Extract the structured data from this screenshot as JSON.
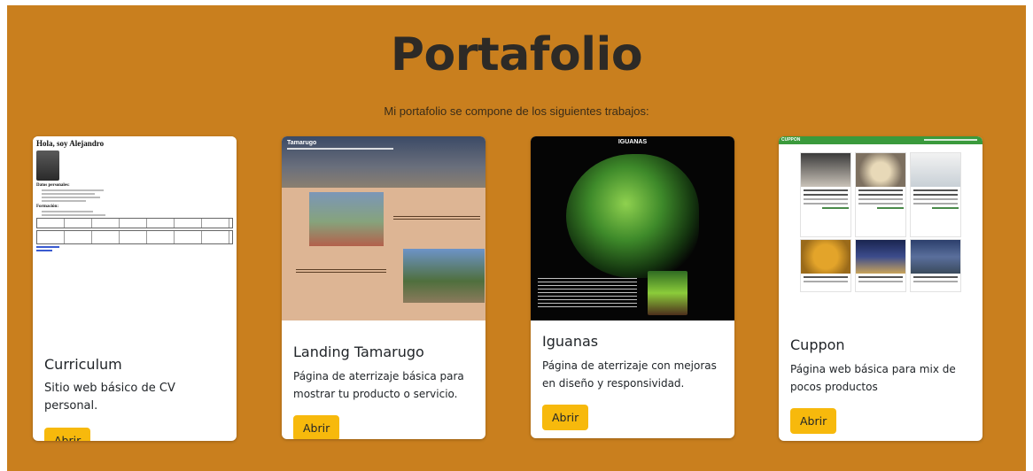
{
  "page": {
    "title": "Portafolio",
    "subtitle": "Mi portafolio se compone de los siguientes trabajos:"
  },
  "colors": {
    "section_bg": "#c97f1e",
    "title": "#2d2a26",
    "button": "#f7b90c",
    "card_bg": "#ffffff"
  },
  "cards": [
    {
      "title": "Curriculum",
      "description": "Sitio web básico de CV personal.",
      "button_label": "Abrir",
      "thumb": {
        "heading": "Hola, soy Alejandro",
        "section_1": "Datos personales:",
        "section_2": "Formación:"
      }
    },
    {
      "title": "Landing Tamarugo",
      "description": "Página de aterrizaje básica para mostrar tu producto o servicio.",
      "button_label": "Abrir",
      "thumb": {
        "heading": "Tamarugo"
      }
    },
    {
      "title": "Iguanas",
      "description": "Página de aterrizaje con mejoras en diseño y responsividad.",
      "button_label": "Abrir",
      "thumb": {
        "heading": "IGUANAS"
      }
    },
    {
      "title": "Cuppon",
      "description": "Página web básica para mix de pocos productos",
      "button_label": "Abrir",
      "thumb": {
        "heading": "CUPPON"
      }
    }
  ]
}
